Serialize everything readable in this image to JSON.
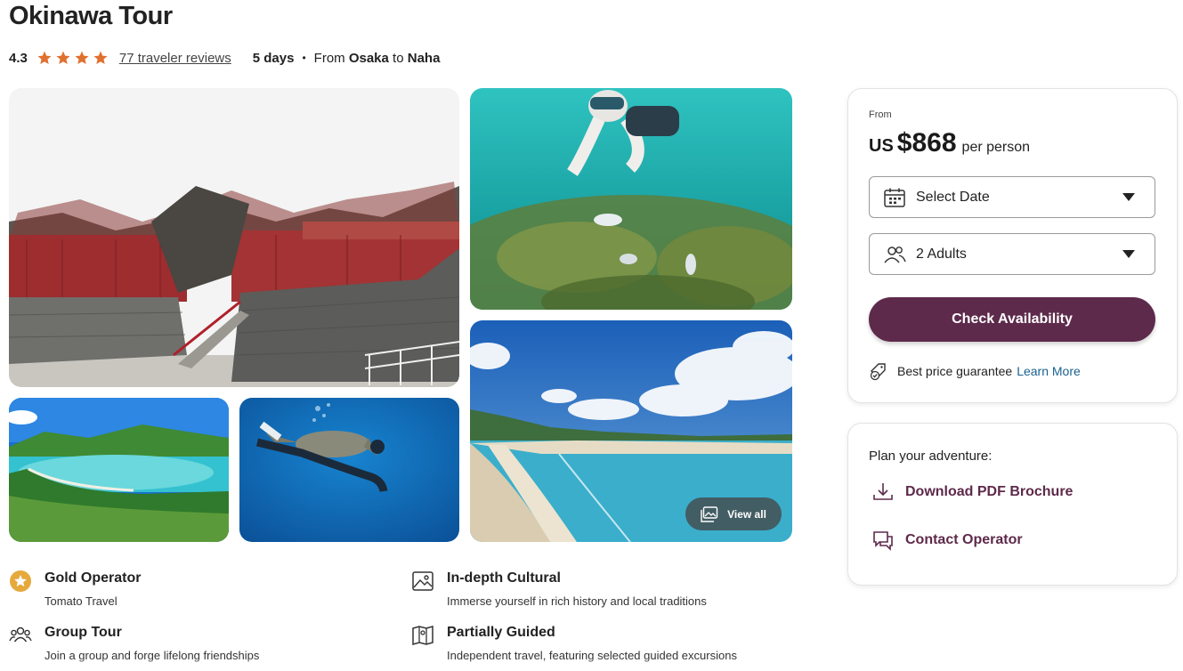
{
  "tour": {
    "title": "Okinawa Tour",
    "rating": "4.3",
    "stars": 4,
    "reviews_label": "77 traveler reviews",
    "days": "5 days",
    "route_from_prefix": "From",
    "route_from": "Osaka",
    "route_to_prefix": "to",
    "route_to": "Naha"
  },
  "gallery": {
    "view_all_label": "View all",
    "photos": [
      "castle-photo",
      "snorkel-photo",
      "bay-photo",
      "turtle-photo",
      "beach-photo"
    ]
  },
  "features": [
    {
      "title": "Gold Operator",
      "subtitle": "Tomato Travel",
      "icon": "gold-badge-icon"
    },
    {
      "title": "In-depth Cultural",
      "subtitle": "Immerse yourself in rich history and local traditions",
      "icon": "image-icon"
    },
    {
      "title": "Group Tour",
      "subtitle": "Join a group and forge lifelong friendships",
      "icon": "group-icon"
    },
    {
      "title": "Partially Guided",
      "subtitle": "Independent travel, featuring selected guided excursions",
      "icon": "map-icon"
    }
  ],
  "booking": {
    "from_label": "From",
    "currency": "US",
    "amount": "$868",
    "per_label": "per person",
    "date_select": "Select Date",
    "travelers_select": "2 Adults",
    "check_label": "Check Availability",
    "guarantee_label": "Best price guarantee",
    "learn_more_label": "Learn More",
    "accent_color": "#5e2a4b",
    "link_color": "#1a6290"
  },
  "plan": {
    "title": "Plan your adventure:",
    "download_label": "Download PDF Brochure",
    "contact_label": "Contact Operator"
  }
}
